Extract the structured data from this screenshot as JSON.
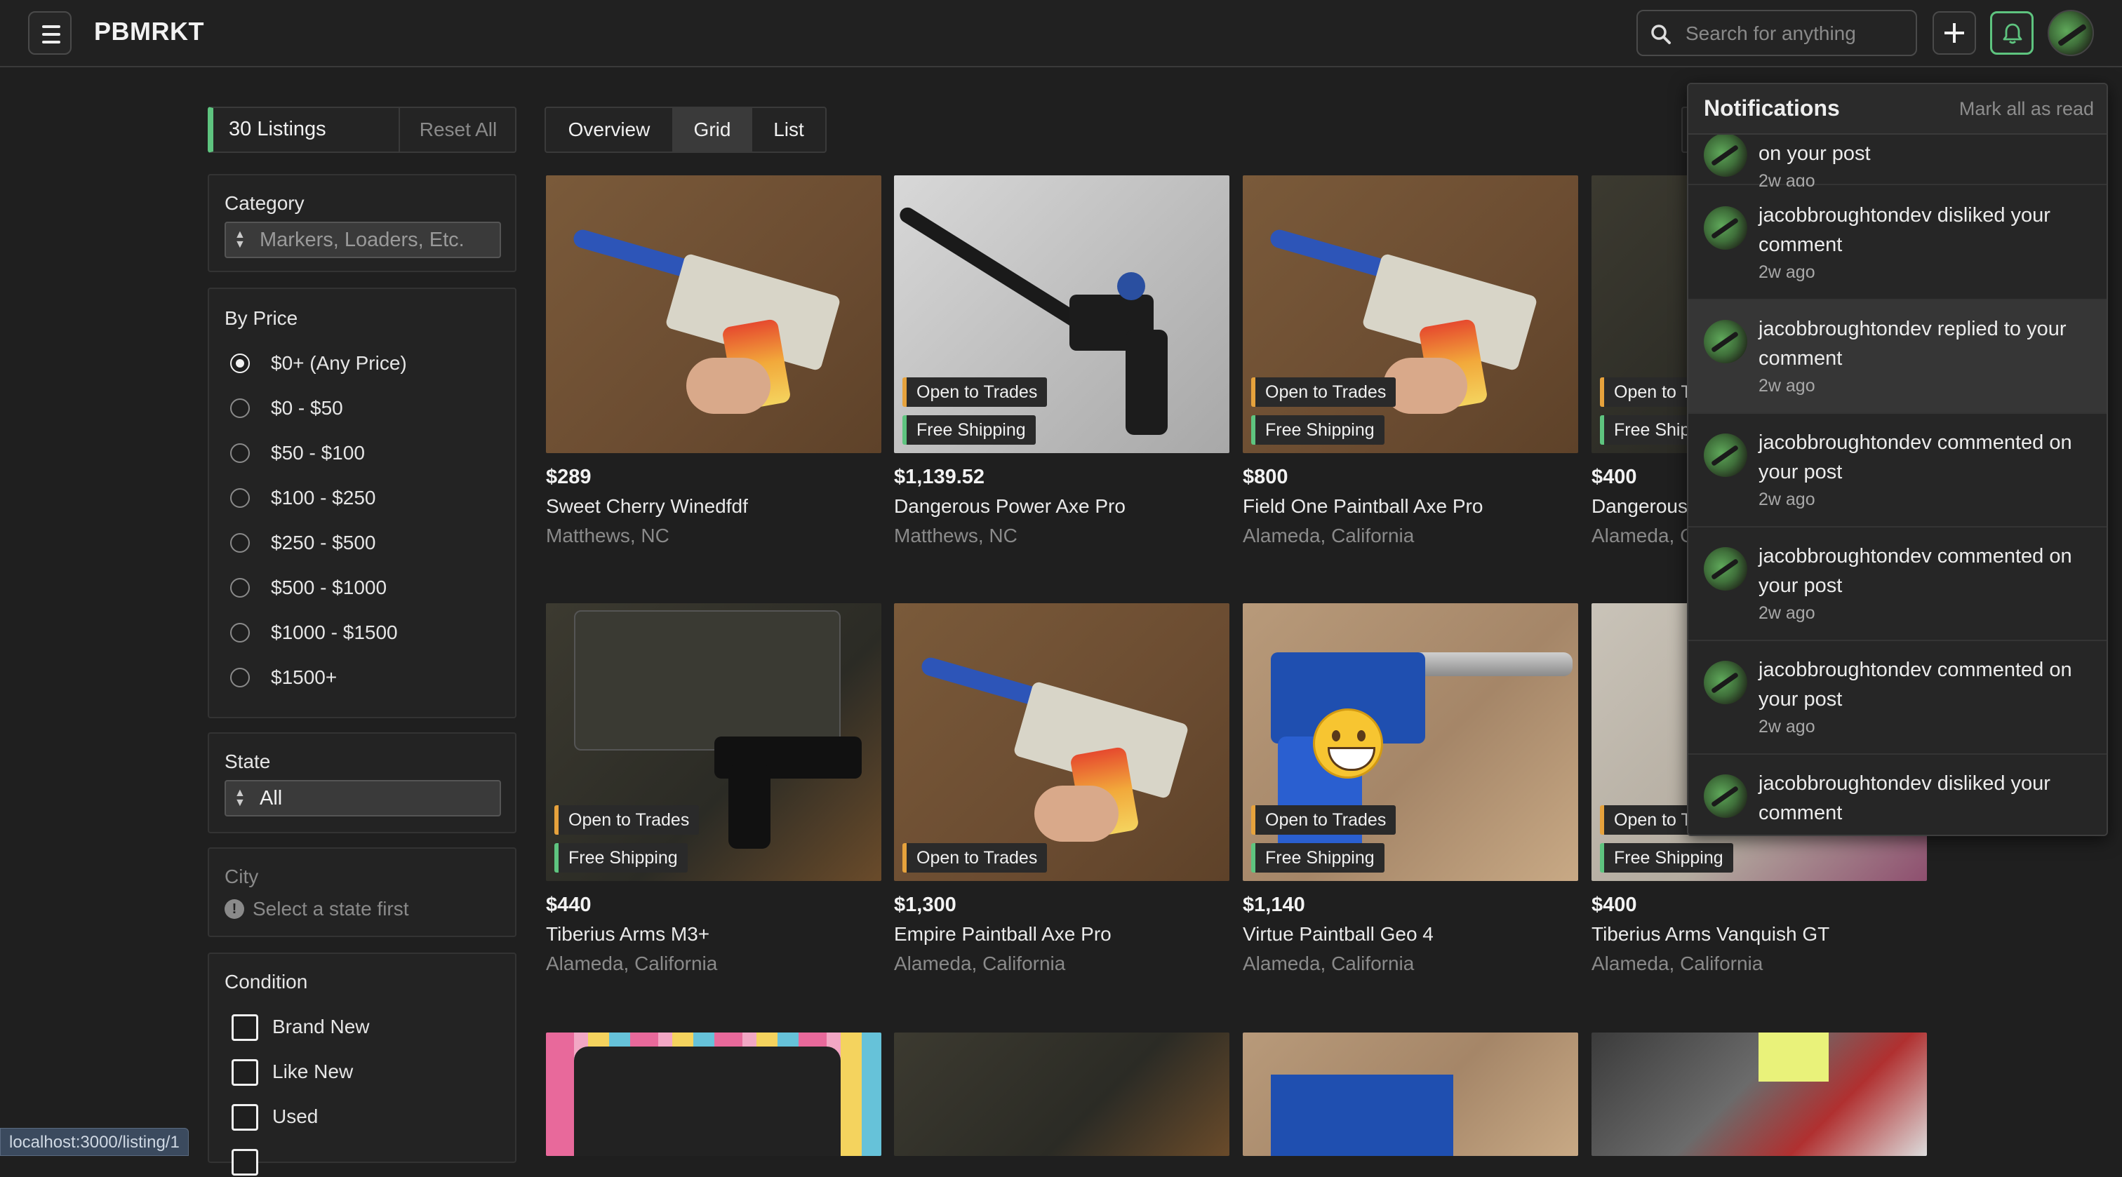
{
  "app": {
    "title": "PBMRKT"
  },
  "header": {
    "search_placeholder": "Search for anything",
    "icons": {
      "menu": "hamburger-icon",
      "search": "search-icon",
      "add": "plus-icon",
      "notifications": "bell-icon"
    }
  },
  "filters": {
    "listing_count": "30 Listings",
    "reset_label": "Reset All",
    "category": {
      "label": "Category",
      "placeholder": "Markers, Loaders, Etc."
    },
    "price": {
      "label": "By Price",
      "selected": "$0+ (Any Price)",
      "options": [
        "$0+ (Any Price)",
        "$0 - $50",
        "$50 - $100",
        "$100 - $250",
        "$250 - $500",
        "$500 - $1000",
        "$1000 - $1500",
        "$1500+"
      ]
    },
    "state": {
      "label": "State",
      "value": "All"
    },
    "city": {
      "label": "City",
      "hint": "Select a state first"
    },
    "condition": {
      "label": "Condition",
      "options": [
        "Brand New",
        "Like New",
        "Used"
      ]
    }
  },
  "view_tabs": {
    "items": [
      "Overview",
      "Grid",
      "List"
    ],
    "active": "Grid"
  },
  "badges": {
    "trades": "Open to Trades",
    "shipping": "Free Shipping"
  },
  "listings": [
    {
      "price": "$289",
      "title": "Sweet Cherry Winedfdf",
      "location": "Matthews, NC",
      "trades": false,
      "shipping": false
    },
    {
      "price": "$1,139.52",
      "title": "Dangerous Power Axe Pro",
      "location": "Matthews, NC",
      "trades": true,
      "shipping": true
    },
    {
      "price": "$800",
      "title": "Field One Paintball Axe Pro",
      "location": "Alameda, California",
      "trades": true,
      "shipping": true
    },
    {
      "price": "$400",
      "title": "Dangerous",
      "location": "Alameda, C",
      "trades": true,
      "shipping": true
    },
    {
      "price": "$440",
      "title": "Tiberius Arms M3+",
      "location": "Alameda, California",
      "trades": true,
      "shipping": true
    },
    {
      "price": "$1,300",
      "title": "Empire Paintball Axe Pro",
      "location": "Alameda, California",
      "trades": true,
      "shipping": false
    },
    {
      "price": "$1,140",
      "title": "Virtue Paintball Geo 4",
      "location": "Alameda, California",
      "trades": true,
      "shipping": true
    },
    {
      "price": "$400",
      "title": "Tiberius Arms Vanquish GT",
      "location": "Alameda, California",
      "trades": true,
      "shipping": true
    }
  ],
  "notifications": {
    "title": "Notifications",
    "mark_all": "Mark all as read",
    "items": [
      {
        "text": "on your post",
        "time": "2w ago"
      },
      {
        "text": "jacobbroughtondev disliked your comment",
        "time": "2w ago"
      },
      {
        "text": "jacobbroughtondev replied to your comment",
        "time": "2w ago",
        "highlight": true
      },
      {
        "text": "jacobbroughtondev commented on your post",
        "time": "2w ago"
      },
      {
        "text": "jacobbroughtondev commented on your post",
        "time": "2w ago"
      },
      {
        "text": "jacobbroughtondev commented on your post",
        "time": "2w ago"
      },
      {
        "text": "jacobbroughtondev disliked your comment",
        "time": ""
      }
    ]
  },
  "status_bar": {
    "url": "localhost:3000/listing/1"
  },
  "colors": {
    "accent": "#5ec47f",
    "trade_badge": "#e6a23c",
    "background": "#1f1f1f"
  }
}
